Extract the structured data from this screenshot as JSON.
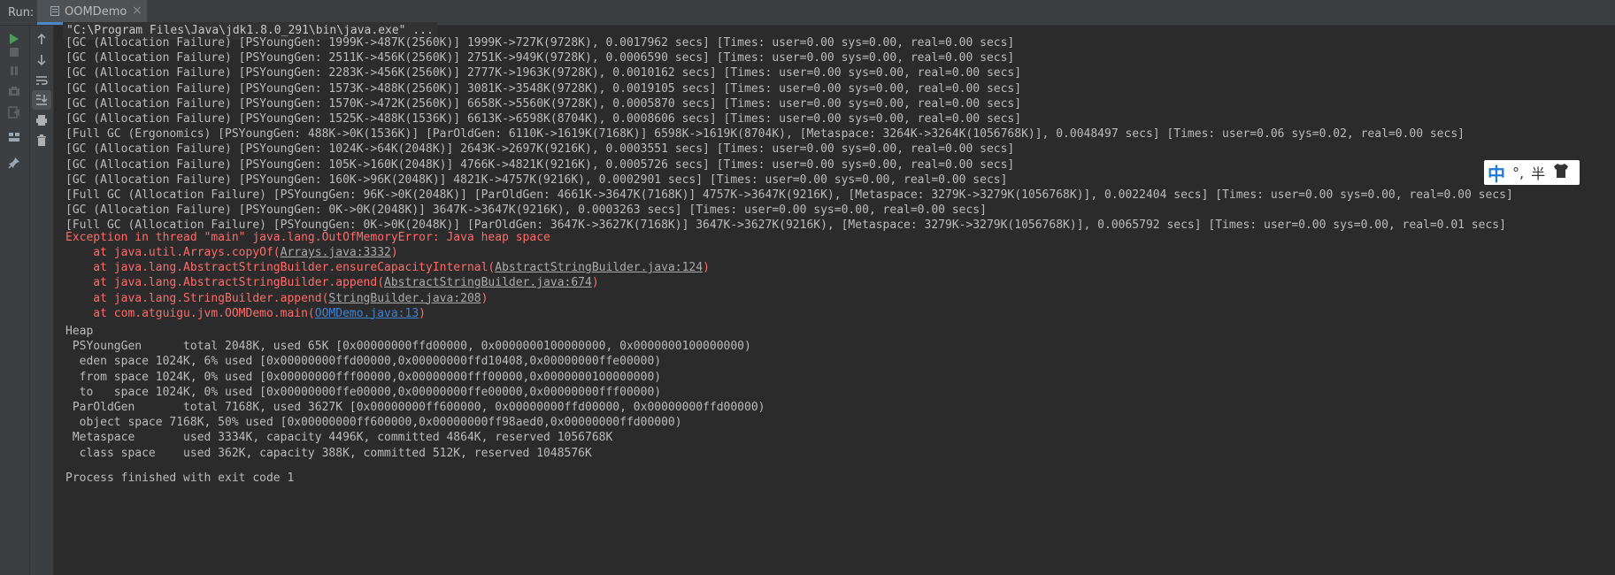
{
  "header": {
    "run_label": "Run:",
    "tab_label": "OOMDemo"
  },
  "toolbar": {
    "outer": [
      "run-icon",
      "stop-icon",
      "pause-icon",
      "camera-icon",
      "exit-icon",
      "layout-icon",
      "pin-icon"
    ],
    "inner": [
      "arrow-up-icon",
      "arrow-down-icon",
      "soft-wrap-icon",
      "scroll-to-end-icon",
      "print-icon",
      "trash-icon"
    ]
  },
  "console": {
    "command": "\"C:\\Program Files\\Java\\jdk1.8.0_291\\bin\\java.exe\" ...",
    "gc_lines": [
      "[GC (Allocation Failure) [PSYoungGen: 1999K->487K(2560K)] 1999K->727K(9728K), 0.0017962 secs] [Times: user=0.00 sys=0.00, real=0.00 secs]",
      "[GC (Allocation Failure) [PSYoungGen: 2511K->456K(2560K)] 2751K->949K(9728K), 0.0006590 secs] [Times: user=0.00 sys=0.00, real=0.00 secs]",
      "[GC (Allocation Failure) [PSYoungGen: 2283K->456K(2560K)] 2777K->1963K(9728K), 0.0010162 secs] [Times: user=0.00 sys=0.00, real=0.00 secs]",
      "[GC (Allocation Failure) [PSYoungGen: 1573K->488K(2560K)] 3081K->3548K(9728K), 0.0019105 secs] [Times: user=0.00 sys=0.00, real=0.00 secs]",
      "[GC (Allocation Failure) [PSYoungGen: 1570K->472K(2560K)] 6658K->5560K(9728K), 0.0005870 secs] [Times: user=0.00 sys=0.00, real=0.00 secs]",
      "[GC (Allocation Failure) [PSYoungGen: 1525K->488K(1536K)] 6613K->6598K(8704K), 0.0008606 secs] [Times: user=0.00 sys=0.00, real=0.00 secs]",
      "[Full GC (Ergonomics) [PSYoungGen: 488K->0K(1536K)] [ParOldGen: 6110K->1619K(7168K)] 6598K->1619K(8704K), [Metaspace: 3264K->3264K(1056768K)], 0.0048497 secs] [Times: user=0.06 sys=0.02, real=0.00 secs]",
      "[GC (Allocation Failure) [PSYoungGen: 1024K->64K(2048K)] 2643K->2697K(9216K), 0.0003551 secs] [Times: user=0.00 sys=0.00, real=0.00 secs]",
      "[GC (Allocation Failure) [PSYoungGen: 105K->160K(2048K)] 4766K->4821K(9216K), 0.0005726 secs] [Times: user=0.00 sys=0.00, real=0.00 secs]",
      "[GC (Allocation Failure) [PSYoungGen: 160K->96K(2048K)] 4821K->4757K(9216K), 0.0002901 secs] [Times: user=0.00 sys=0.00, real=0.00 secs]",
      "[Full GC (Allocation Failure) [PSYoungGen: 96K->0K(2048K)] [ParOldGen: 4661K->3647K(7168K)] 4757K->3647K(9216K), [Metaspace: 3279K->3279K(1056768K)], 0.0022404 secs] [Times: user=0.00 sys=0.00, real=0.00 secs]",
      "[GC (Allocation Failure) [PSYoungGen: 0K->0K(2048K)] 3647K->3647K(9216K), 0.0003263 secs] [Times: user=0.00 sys=0.00, real=0.00 secs]",
      "[Full GC (Allocation Failure) [PSYoungGen: 0K->0K(2048K)] [ParOldGen: 3647K->3627K(7168K)] 3647K->3627K(9216K), [Metaspace: 3279K->3279K(1056768K)], 0.0065792 secs] [Times: user=0.00 sys=0.00, real=0.01 secs]"
    ],
    "exception": "Exception in thread \"main\" java.lang.OutOfMemoryError: Java heap space",
    "stack": [
      {
        "prefix": "    at java.util.Arrays.copyOf(",
        "link": "Arrays.java:3332",
        "suffix": ")",
        "blue": false
      },
      {
        "prefix": "    at java.lang.AbstractStringBuilder.ensureCapacityInternal(",
        "link": "AbstractStringBuilder.java:124",
        "suffix": ")",
        "blue": false
      },
      {
        "prefix": "    at java.lang.AbstractStringBuilder.append(",
        "link": "AbstractStringBuilder.java:674",
        "suffix": ")",
        "blue": false
      },
      {
        "prefix": "    at java.lang.StringBuilder.append(",
        "link": "StringBuilder.java:208",
        "suffix": ")",
        "blue": false
      },
      {
        "prefix": "    at com.atguigu.jvm.OOMDemo.main(",
        "link": "OOMDemo.java:13",
        "suffix": ")",
        "blue": true
      }
    ],
    "heap_lines": [
      "Heap",
      " PSYoungGen      total 2048K, used 65K [0x00000000ffd00000, 0x0000000100000000, 0x0000000100000000)",
      "  eden space 1024K, 6% used [0x00000000ffd00000,0x00000000ffd10408,0x00000000ffe00000)",
      "  from space 1024K, 0% used [0x00000000fff00000,0x00000000fff00000,0x0000000100000000)",
      "  to   space 1024K, 0% used [0x00000000ffe00000,0x00000000ffe00000,0x00000000fff00000)",
      " ParOldGen       total 7168K, used 3627K [0x00000000ff600000, 0x00000000ffd00000, 0x00000000ffd00000)",
      "  object space 7168K, 50% used [0x00000000ff600000,0x00000000ff98aed0,0x00000000ffd00000)",
      " Metaspace       used 3334K, capacity 4496K, committed 4864K, reserved 1056768K",
      "  class space    used 362K, capacity 388K, committed 512K, reserved 1048576K"
    ],
    "exit_message": "Process finished with exit code 1"
  },
  "ime": {
    "lang": "中",
    "punctuation": "°,",
    "width_mode": "半",
    "skin_icon": "shirt-icon"
  }
}
